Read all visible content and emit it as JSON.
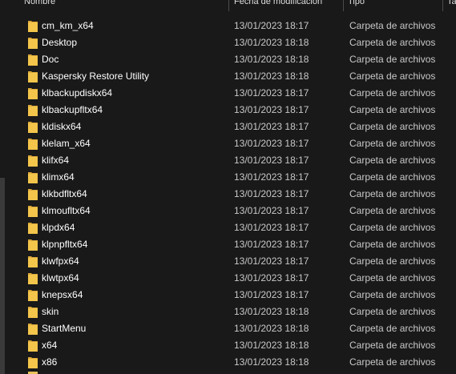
{
  "columns": {
    "name": "Nombre",
    "date": "Fecha de modificación",
    "type": "Tipo",
    "size": "Ta"
  },
  "colors": {
    "background": "#191919",
    "folder": "#f3c54b",
    "folder_dark": "#dba83a",
    "text": "#ffffff",
    "subtext": "#c8c8c8"
  },
  "files": [
    {
      "name": "cm_km_x64",
      "date": "13/01/2023 18:17",
      "type": "Carpeta de archivos",
      "icon": "folder-icon"
    },
    {
      "name": "Desktop",
      "date": "13/01/2023 18:18",
      "type": "Carpeta de archivos",
      "icon": "folder-icon"
    },
    {
      "name": "Doc",
      "date": "13/01/2023 18:18",
      "type": "Carpeta de archivos",
      "icon": "folder-icon"
    },
    {
      "name": "Kaspersky Restore Utility",
      "date": "13/01/2023 18:18",
      "type": "Carpeta de archivos",
      "icon": "folder-icon"
    },
    {
      "name": "klbackupdiskx64",
      "date": "13/01/2023 18:17",
      "type": "Carpeta de archivos",
      "icon": "folder-icon"
    },
    {
      "name": "klbackupfltx64",
      "date": "13/01/2023 18:17",
      "type": "Carpeta de archivos",
      "icon": "folder-icon"
    },
    {
      "name": "kldiskx64",
      "date": "13/01/2023 18:17",
      "type": "Carpeta de archivos",
      "icon": "folder-icon"
    },
    {
      "name": "klelam_x64",
      "date": "13/01/2023 18:17",
      "type": "Carpeta de archivos",
      "icon": "folder-icon"
    },
    {
      "name": "klifx64",
      "date": "13/01/2023 18:17",
      "type": "Carpeta de archivos",
      "icon": "folder-icon"
    },
    {
      "name": "klimx64",
      "date": "13/01/2023 18:17",
      "type": "Carpeta de archivos",
      "icon": "folder-icon"
    },
    {
      "name": "klkbdfltx64",
      "date": "13/01/2023 18:17",
      "type": "Carpeta de archivos",
      "icon": "folder-icon"
    },
    {
      "name": "klmoufltx64",
      "date": "13/01/2023 18:17",
      "type": "Carpeta de archivos",
      "icon": "folder-icon"
    },
    {
      "name": "klpdx64",
      "date": "13/01/2023 18:17",
      "type": "Carpeta de archivos",
      "icon": "folder-icon"
    },
    {
      "name": "klpnpfltx64",
      "date": "13/01/2023 18:17",
      "type": "Carpeta de archivos",
      "icon": "folder-icon"
    },
    {
      "name": "klwfpx64",
      "date": "13/01/2023 18:17",
      "type": "Carpeta de archivos",
      "icon": "folder-icon"
    },
    {
      "name": "klwtpx64",
      "date": "13/01/2023 18:17",
      "type": "Carpeta de archivos",
      "icon": "folder-icon"
    },
    {
      "name": "knepsx64",
      "date": "13/01/2023 18:17",
      "type": "Carpeta de archivos",
      "icon": "folder-icon"
    },
    {
      "name": "skin",
      "date": "13/01/2023 18:18",
      "type": "Carpeta de archivos",
      "icon": "folder-icon"
    },
    {
      "name": "StartMenu",
      "date": "13/01/2023 18:18",
      "type": "Carpeta de archivos",
      "icon": "folder-icon"
    },
    {
      "name": "x64",
      "date": "13/01/2023 18:18",
      "type": "Carpeta de archivos",
      "icon": "folder-icon"
    },
    {
      "name": "x86",
      "date": "13/01/2023 18:18",
      "type": "Carpeta de archivos",
      "icon": "folder-icon"
    }
  ]
}
